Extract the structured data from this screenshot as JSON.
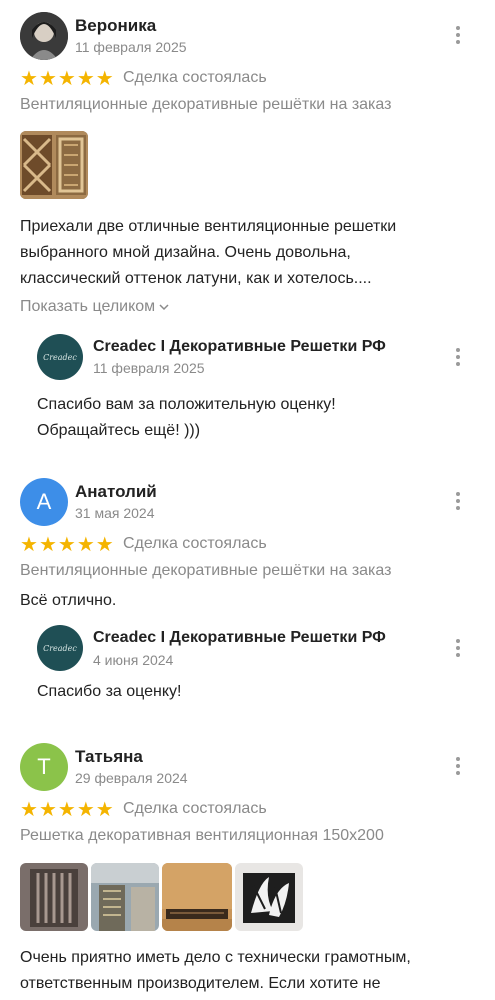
{
  "reviews": [
    {
      "author": "Вероника",
      "date": "11 февраля 2025",
      "rating": 5,
      "deal_status": "Сделка состоялась",
      "product": "Вентиляционные декоративные решётки на заказ",
      "text_line1": "Приехали две отличные вентиляционные решетки",
      "text_line2": "выбранного мной дизайна. Очень довольна,",
      "text_line3": "классический оттенок латуни, как и хотелось....",
      "show_more": "Показать целиком",
      "reply": {
        "author": "Creadec I Декоративные Решетки РФ",
        "date": "11 февраля 2025",
        "text_line1": "Спасибо вам за положительную оценку!",
        "text_line2": "Обращайтесь ещё! )))"
      }
    },
    {
      "author": "Анатолий",
      "avatar_letter": "А",
      "date": "31 мая 2024",
      "rating": 5,
      "deal_status": "Сделка состоялась",
      "product": "Вентиляционные декоративные решётки на заказ",
      "text_line1": "Всё отлично.",
      "reply": {
        "author": "Creadec I Декоративные Решетки РФ",
        "date": "4 июня 2024",
        "text_line1": "Спасибо за оценку!"
      }
    },
    {
      "author": "Татьяна",
      "avatar_letter": "Т",
      "date": "29 февраля 2024",
      "rating": 5,
      "deal_status": "Сделка состоялась",
      "product": "Решетка декоративная вентиляционная 150х200",
      "text_line1": "Очень приятно иметь дело с технически грамотным,",
      "text_line2": "ответственным производителем. Если хотите не"
    }
  ],
  "reply_avatar_text": "Creadec",
  "star_glyph": "★",
  "colors": {
    "star": "#f4b400",
    "avatar_blue": "#3d8ee8",
    "avatar_green": "#8bc34a",
    "reply_avatar": "#1f4f55",
    "muted_text": "#8a8a8a"
  }
}
